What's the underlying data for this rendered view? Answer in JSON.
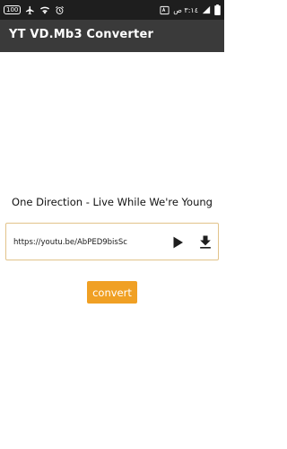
{
  "status_bar": {
    "battery": "100",
    "time": "٣:١٤ ص",
    "icons_left": [
      "battery-icon",
      "airplane-icon",
      "wifi-icon",
      "alarm-icon"
    ],
    "icons_right": [
      "translate-icon",
      "signal-icon",
      "battery-status-icon"
    ]
  },
  "app": {
    "title": "YT VD.Mb3 Converter"
  },
  "main": {
    "video_title": "One Direction - Live While We're Young",
    "url_value": "https://youtu.be/AbPED9bisSc",
    "convert_label": "convert"
  },
  "colors": {
    "status_bar_bg": "#1e1e1e",
    "app_bar_bg": "#3a3a3a",
    "accent": "#f0a024",
    "input_border": "#e2c38a"
  }
}
